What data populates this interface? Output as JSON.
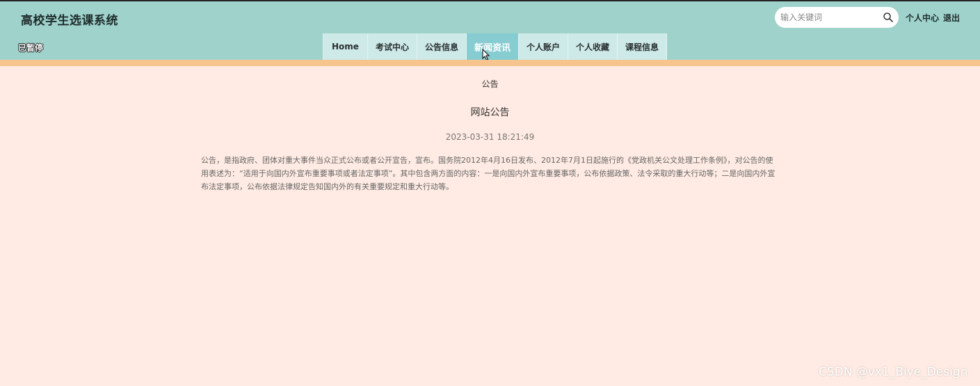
{
  "header": {
    "site_title": "高校学生选课系统",
    "search": {
      "placeholder": "输入关键词",
      "value": ""
    },
    "user_center": "个人中心",
    "logout": "退出",
    "paused_label": "已暂停"
  },
  "nav": {
    "items": [
      {
        "label": "Home"
      },
      {
        "label": "考试中心"
      },
      {
        "label": "公告信息"
      },
      {
        "label": "新闻资讯"
      },
      {
        "label": "个人账户"
      },
      {
        "label": "个人收藏"
      },
      {
        "label": "课程信息"
      }
    ],
    "active": "新闻资讯"
  },
  "breadcrumb": "公告",
  "article": {
    "title": "网站公告",
    "date": "2023-03-31 18:21:49",
    "body": "公告，是指政府、团体对重大事件当众正式公布或者公开宣告，宣布。国务院2012年4月16日发布、2012年7月1日起施行的《党政机关公文处理工作条例》，对公告的使用表述为：“适用于向国内外宣布重要事项或者法定事项”。其中包含两方面的内容：一是向国内外宣布重要事项，公布依据政策、法令采取的重大行动等；二是向国内外宣布法定事项，公布依据法律规定告知国内外的有关重要规定和重大行动等。"
  },
  "watermark": "CSDN @vx1_Biye_Design",
  "colors": {
    "header_bg": "#9ed2cb",
    "nav_bg": "#cdeae9",
    "nav_active_bg": "#86ccd0",
    "accent_bar": "#f8c48d",
    "page_bg": "#ffebe3"
  }
}
